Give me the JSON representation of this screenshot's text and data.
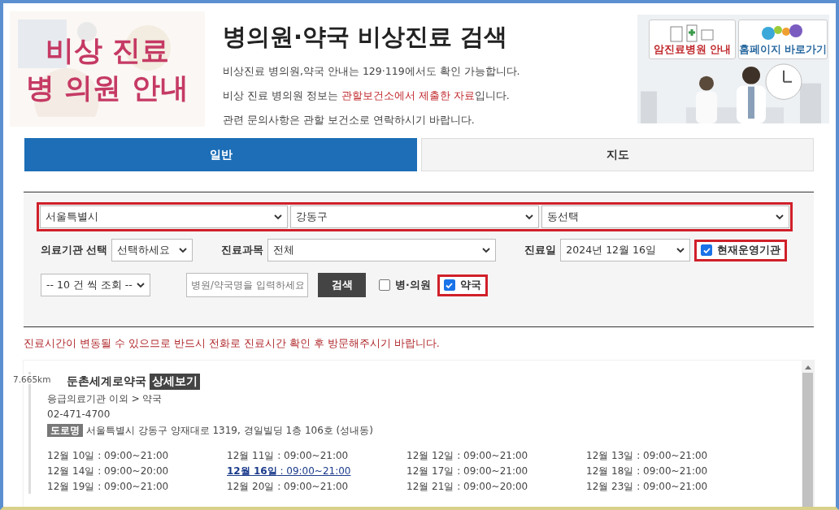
{
  "banner": {
    "lines": [
      "비상 진료",
      "병 의원 안내"
    ]
  },
  "header": {
    "title": "병의원·약국 비상진료 검색",
    "notes": [
      [
        {
          "text": "비상진료 병의원,약국 안내는 129·119에서도 확인 가능합니다.",
          "highlight": false
        }
      ],
      [
        {
          "text": "비상 진료 병의원 정보는 ",
          "highlight": false
        },
        {
          "text": "관할보건소에서 제출한 자료",
          "highlight": true
        },
        {
          "text": "입니다.",
          "highlight": false
        }
      ],
      [
        {
          "text": "관련 문의사항은 관할 보건소로 연락하시기 바랍니다.",
          "highlight": false
        }
      ]
    ]
  },
  "side_links": [
    {
      "label": "암진료병원 안내",
      "kind": "hospital"
    },
    {
      "label": "홈페이지 바로가기",
      "kind": "homepage"
    }
  ],
  "tabs": [
    {
      "label": "일반",
      "selected": true
    },
    {
      "label": "지도",
      "selected": false
    }
  ],
  "search": {
    "region_selects": [
      "서울특별시",
      "강동구",
      "동선택"
    ],
    "region_highlighted": true,
    "facility_label": "의료기관 선택",
    "facility_value": "선택하세요",
    "department_label": "진료과목",
    "department_value": "전체",
    "date_label": "진료일",
    "date_value": "2024년 12월 16일",
    "open_now": {
      "label": "현재운영기관",
      "checked": true,
      "highlighted": true
    },
    "page_size": "-- 10 건 씩 조회 --",
    "name_field": {
      "placeholder": "병원/약국명을 입력하세요"
    },
    "search_button": "검색",
    "types": [
      {
        "label": "병·의원",
        "checked": false,
        "highlighted": false
      },
      {
        "label": "약국",
        "checked": true,
        "highlighted": true
      }
    ]
  },
  "notice": "진료시간이 변동될 수 있으므로 반드시 전화로 진료시간 확인 후 방문해주시기 바랍니다.",
  "results": [
    {
      "distance": "7.665km",
      "name": "둔촌세계로약국",
      "detail_button": "상세보기",
      "category": "응급의료기관 이외 > 약국",
      "phone": "02-471-4700",
      "address_tag": "도로명",
      "address": "서울특별시 강동구 양재대로 1319, 경일빌딩 1층 106호 (성내동)",
      "hours": [
        {
          "text": "12월 10일 : 09:00~21:00",
          "selected": false
        },
        {
          "text": "12월 11일 : 09:00~21:00",
          "selected": false
        },
        {
          "text": "12월 12일 : 09:00~21:00",
          "selected": false
        },
        {
          "text": "12월 13일 : 09:00~21:00",
          "selected": false
        },
        {
          "text": "12월 14일 : 09:00~20:00",
          "selected": false
        },
        {
          "text": "**12월 16일** : 09:00~21:00",
          "selected": true
        },
        {
          "text": "12월 17일 : 09:00~21:00",
          "selected": false
        },
        {
          "text": "12월 18일 : 09:00~21:00",
          "selected": false
        },
        {
          "text": "12월 19일 : 09:00~21:00",
          "selected": false
        },
        {
          "text": "12월 20일 : 09:00~21:00",
          "selected": false
        },
        {
          "text": "12월 21일 : 09:00~20:00",
          "selected": false
        },
        {
          "text": "12월 23일 : 09:00~21:00",
          "selected": false
        }
      ]
    }
  ]
}
